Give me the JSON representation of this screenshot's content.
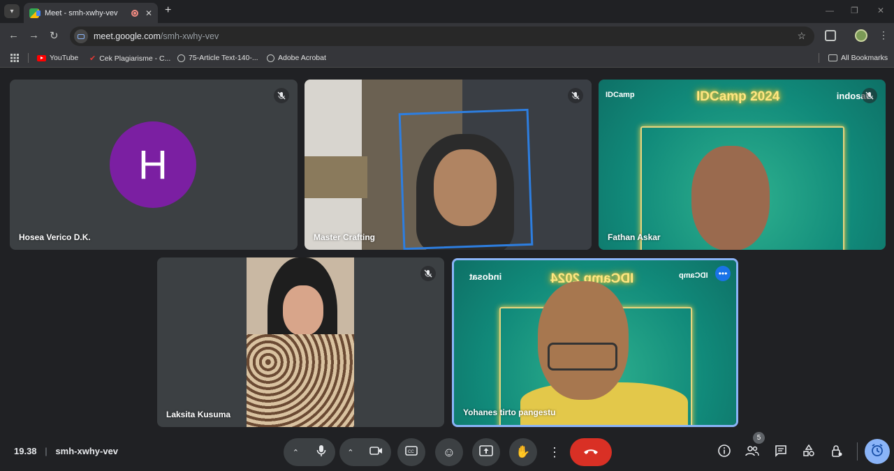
{
  "browser": {
    "tab_title": "Meet - smh-xwhy-vev",
    "url_host": "meet.google.com",
    "url_path": "/smh-xwhy-vev",
    "bookmarks": [
      "YouTube",
      "Cek Plagiarisme - C...",
      "75-Article Text-140-...",
      "Adobe Acrobat"
    ],
    "all_bookmarks": "All Bookmarks"
  },
  "participants": [
    {
      "name": "Hosea Verico D.K.",
      "initial": "H",
      "muted": true,
      "avatar_color": "#7b1fa2"
    },
    {
      "name": "Master Crafting",
      "muted": true
    },
    {
      "name": "Fathan Askar",
      "muted": true
    },
    {
      "name": "Laksita Kusuma",
      "muted": true
    },
    {
      "name": "Yohanes tirto pangestu",
      "muted": false,
      "active_speaker": true
    }
  ],
  "background_text": {
    "idcamp": "IDCamp",
    "idcamp_2024": "IDCamp 2024",
    "indosat": "indosat"
  },
  "footer": {
    "time": "19.38",
    "meeting_code": "smh-xwhy-vev",
    "people_count": "5"
  },
  "colors": {
    "leave": "#d93025",
    "highlight": "#8ab4f8",
    "teal_bg": "#118a7a"
  }
}
